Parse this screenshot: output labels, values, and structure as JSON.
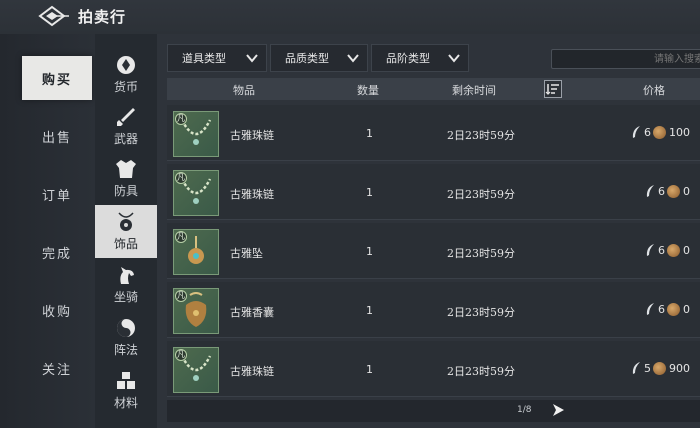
{
  "header": {
    "title": "拍卖行",
    "back_icon": "diamond-back-icon"
  },
  "left_tabs": [
    "购买",
    "出售",
    "订单",
    "完成",
    "收购",
    "关注"
  ],
  "active_left_tab": 0,
  "categories": [
    {
      "label": "货币",
      "icon": "coin-icon"
    },
    {
      "label": "武器",
      "icon": "sword-icon"
    },
    {
      "label": "防具",
      "icon": "armor-icon"
    },
    {
      "label": "饰品",
      "icon": "pendant-icon"
    },
    {
      "label": "坐骑",
      "icon": "horse-icon"
    },
    {
      "label": "阵法",
      "icon": "taichi-icon"
    },
    {
      "label": "材料",
      "icon": "blocks-icon"
    }
  ],
  "active_category": 3,
  "filters": [
    "道具类型",
    "品质类型",
    "品阶类型"
  ],
  "search": {
    "placeholder": "请输入搜索"
  },
  "table": {
    "headers": {
      "item": "物品",
      "qty": "数量",
      "time": "剩余时间",
      "price": "价格"
    },
    "rows": [
      {
        "grade": "凡",
        "name": "古雅珠链",
        "qty": "1",
        "time": "2日23时59分",
        "p1": "6",
        "p2": "100"
      },
      {
        "grade": "凡",
        "name": "古雅珠链",
        "qty": "1",
        "time": "2日23时59分",
        "p1": "6",
        "p2": "0"
      },
      {
        "grade": "凡",
        "name": "古雅坠",
        "qty": "1",
        "time": "2日23时59分",
        "p1": "6",
        "p2": "0"
      },
      {
        "grade": "凡",
        "name": "古雅香囊",
        "qty": "1",
        "time": "2日23时59分",
        "p1": "6",
        "p2": "0"
      },
      {
        "grade": "凡",
        "name": "古雅珠链",
        "qty": "1",
        "time": "2日23时59分",
        "p1": "5",
        "p2": "900"
      }
    ]
  },
  "pager": {
    "text": "1/8"
  },
  "colors": {
    "bg": "#2e333a",
    "active_tab": "#e8e8e6",
    "coin": "#c58f50"
  }
}
